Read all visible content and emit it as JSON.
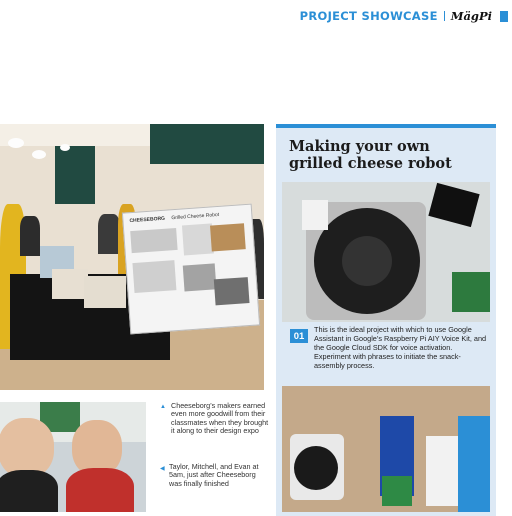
{
  "header": {
    "section_title": "PROJECT SHOWCASE",
    "magazine": "MägPi"
  },
  "main_photo": {
    "poster_heading": "CHEESEBORG",
    "poster_subheading": "Grilled Cheese Robot"
  },
  "captions": {
    "first": "Cheeseborg’s makers earned even more goodwill from their classmates when they brought it along to their design expo",
    "second": "Taylor, Mitchell, and Evan at 5am, just after Cheeseborg was finally finished"
  },
  "box": {
    "title_line1": "Making your own",
    "title_line2": "grilled cheese robot",
    "step_number": "01",
    "step_text": "This is the ideal project with which to use Google Assistant in Google’s Raspberry Pi AIY Voice Kit, and the Google Cloud SDK for voice activation. Experiment with phrases to initiate the snack-assembly process."
  },
  "colors": {
    "accent": "#2b8fd6",
    "box_bg": "#dde9f5"
  }
}
